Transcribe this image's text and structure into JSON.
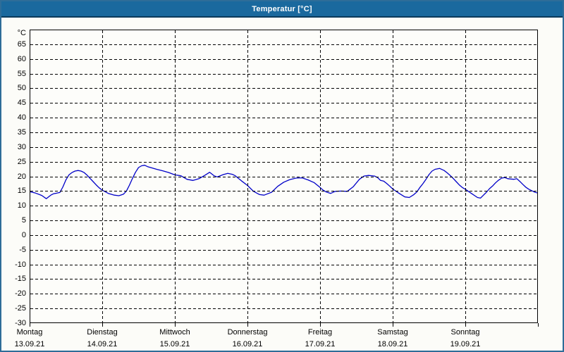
{
  "window": {
    "title": "Temperatur [°C]"
  },
  "colors": {
    "titlebar": "#1a699e",
    "titlebar_edge": "#0b3a5c",
    "frame": "#2e6d98",
    "content_background": "#fcfcf8",
    "plot_border": "#000000",
    "gridline": "#000000",
    "series_line": "#0000c8",
    "title_text": "#ffffff",
    "label_text": "#000000"
  },
  "chart_data": {
    "type": "line",
    "title": "Temperatur [°C]",
    "ylabel": "°C",
    "legend_position": "none",
    "grid_style": "dashed",
    "y_axis": {
      "min": -30,
      "max": 70,
      "tick_step": 5,
      "unit_label": "°C",
      "tick_labels": [
        "65",
        "60",
        "55",
        "50",
        "45",
        "40",
        "35",
        "30",
        "25",
        "20",
        "15",
        "10",
        "5",
        "0",
        "-5",
        "-10",
        "-15",
        "-20",
        "-25",
        "-30"
      ]
    },
    "x_axis": {
      "range_hours": [
        0,
        168
      ],
      "days": [
        {
          "name": "Montag",
          "date": "13.09.21"
        },
        {
          "name": "Dienstag",
          "date": "14.09.21"
        },
        {
          "name": "Mittwoch",
          "date": "15.09.21"
        },
        {
          "name": "Donnerstag",
          "date": "16.09.21"
        },
        {
          "name": "Freitag",
          "date": "17.09.21"
        },
        {
          "name": "Samstag",
          "date": "18.09.21"
        },
        {
          "name": "Sonntag",
          "date": "19.09.21"
        }
      ]
    },
    "series": [
      {
        "name": "Temperatur",
        "unit": "°C",
        "color": "#0000c8",
        "points": [
          [
            0,
            14.8
          ],
          [
            2,
            14.3
          ],
          [
            4,
            13.5
          ],
          [
            5.5,
            12.4
          ],
          [
            7,
            13.6
          ],
          [
            8,
            14.1
          ],
          [
            9,
            14.3
          ],
          [
            10,
            14.5
          ],
          [
            11,
            16.4
          ],
          [
            12,
            18.8
          ],
          [
            13,
            20.5
          ],
          [
            14,
            21.3
          ],
          [
            15,
            21.8
          ],
          [
            16,
            22.0
          ],
          [
            17,
            21.8
          ],
          [
            18,
            21.3
          ],
          [
            19,
            20.4
          ],
          [
            20,
            19.3
          ],
          [
            21,
            18.2
          ],
          [
            22,
            17.1
          ],
          [
            23,
            16.1
          ],
          [
            24,
            15.3
          ],
          [
            26,
            14.2
          ],
          [
            28,
            13.6
          ],
          [
            29.5,
            13.4
          ],
          [
            31,
            13.9
          ],
          [
            32,
            15.0
          ],
          [
            33,
            17.0
          ],
          [
            34,
            19.3
          ],
          [
            35,
            21.4
          ],
          [
            36,
            23.0
          ],
          [
            37,
            23.6
          ],
          [
            38,
            23.8
          ],
          [
            39,
            23.3
          ],
          [
            40,
            23.0
          ],
          [
            42,
            22.4
          ],
          [
            44,
            21.9
          ],
          [
            46,
            21.3
          ],
          [
            48,
            20.5
          ],
          [
            50,
            20.2
          ],
          [
            52,
            19.0
          ],
          [
            54,
            18.6
          ],
          [
            56,
            19.2
          ],
          [
            58,
            20.4
          ],
          [
            59.5,
            21.4
          ],
          [
            61,
            20.2
          ],
          [
            62,
            19.8
          ],
          [
            64,
            20.6
          ],
          [
            65.5,
            21.0
          ],
          [
            67,
            20.7
          ],
          [
            68,
            20.2
          ],
          [
            70,
            18.5
          ],
          [
            72,
            16.9
          ],
          [
            74,
            14.9
          ],
          [
            76,
            13.8
          ],
          [
            77.5,
            13.6
          ],
          [
            80,
            14.6
          ],
          [
            82,
            16.6
          ],
          [
            84,
            18.0
          ],
          [
            86,
            18.9
          ],
          [
            88,
            19.4
          ],
          [
            90,
            19.5
          ],
          [
            92,
            18.8
          ],
          [
            94,
            17.9
          ],
          [
            96,
            16.2
          ],
          [
            97,
            15.3
          ],
          [
            98,
            14.7
          ],
          [
            99.5,
            14.2
          ],
          [
            101,
            14.9
          ],
          [
            103,
            15.0
          ],
          [
            105,
            14.9
          ],
          [
            107,
            16.5
          ],
          [
            109,
            19.0
          ],
          [
            110.5,
            20.1
          ],
          [
            112,
            20.3
          ],
          [
            114,
            20.1
          ],
          [
            115,
            19.6
          ],
          [
            116,
            18.6
          ],
          [
            117,
            18.4
          ],
          [
            118,
            17.6
          ],
          [
            119,
            16.7
          ],
          [
            120,
            15.7
          ],
          [
            122,
            14.3
          ],
          [
            124,
            13.0
          ],
          [
            125.5,
            12.8
          ],
          [
            127,
            13.8
          ],
          [
            128,
            14.7
          ],
          [
            129,
            16.2
          ],
          [
            130,
            17.5
          ],
          [
            131,
            19.0
          ],
          [
            132,
            20.6
          ],
          [
            133,
            21.8
          ],
          [
            134,
            22.4
          ],
          [
            135.5,
            22.7
          ],
          [
            137,
            22.0
          ],
          [
            138,
            21.2
          ],
          [
            139,
            20.3
          ],
          [
            140,
            19.3
          ],
          [
            141,
            18.2
          ],
          [
            142,
            17.1
          ],
          [
            143,
            16.2
          ],
          [
            144,
            15.6
          ],
          [
            146,
            14.2
          ],
          [
            148,
            12.8
          ],
          [
            149,
            12.6
          ],
          [
            151,
            14.6
          ],
          [
            152,
            15.8
          ],
          [
            153,
            16.7
          ],
          [
            154,
            17.8
          ],
          [
            155,
            18.7
          ],
          [
            156,
            19.4
          ],
          [
            157,
            19.6
          ],
          [
            158,
            19.2
          ],
          [
            160,
            19.0
          ],
          [
            161,
            19.2
          ],
          [
            162,
            18.3
          ],
          [
            163,
            17.3
          ],
          [
            164,
            16.3
          ],
          [
            165,
            15.6
          ],
          [
            166,
            15.1
          ],
          [
            167,
            14.6
          ],
          [
            168,
            14.3
          ]
        ]
      }
    ]
  }
}
